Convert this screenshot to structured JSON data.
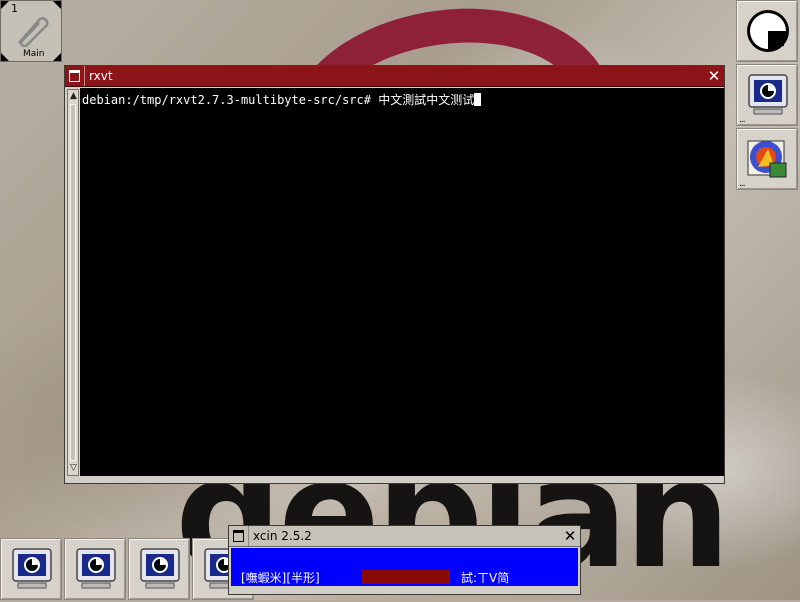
{
  "desktop": {
    "background_word": "debian",
    "accent_color": "#8d1b33"
  },
  "pager": {
    "desk_number": "1",
    "desk_label": "Main"
  },
  "right_dock": [
    {
      "icon": "gnome-foot-icon",
      "dots": ""
    },
    {
      "icon": "monitor-icon",
      "dots": "..."
    },
    {
      "icon": "gimp-icon",
      "dots": "..."
    }
  ],
  "bottom_dock": [
    {
      "icon": "monitor-icon"
    },
    {
      "icon": "monitor-icon"
    },
    {
      "icon": "monitor-icon"
    },
    {
      "icon": "monitor-icon"
    }
  ],
  "rxvt": {
    "title": "rxvt",
    "close_glyph": "✕",
    "title_color": "#8a1418",
    "terminal_line": "debian:/tmp/rxvt2.7.3-multibyte-src/src# 中文測試中文测试"
  },
  "xcin": {
    "title": "xcin 2.5.2",
    "close_glyph": "✕",
    "status_text": "[嘸蝦米][半形]",
    "code_text": "試:ㄒV简",
    "body_color": "#0000ff"
  }
}
